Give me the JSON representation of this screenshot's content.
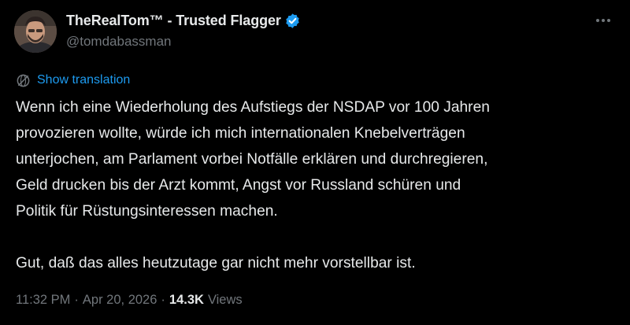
{
  "author": {
    "display_name": "TheRealTom™ - Trusted Flagger",
    "handle": "@tomdabassman",
    "verified": true,
    "avatar": "profile-photo"
  },
  "actions": {
    "more_icon": "more-horizontal-icon"
  },
  "translation": {
    "label": "Show translation",
    "icon": "globe-icon",
    "color": "#1d9bf0"
  },
  "tweet": {
    "paragraph1_lines": [
      "Wenn ich eine Wiederholung des Aufstiegs der NSDAP vor 100 Jahren",
      "provozieren wollte, würde ich mich internationalen Knebelverträgen",
      "unterjochen, am Parlament vorbei Notfälle erklären und durchregieren,",
      "Geld drucken bis der Arzt kommt, Angst vor Russland schüren und",
      "Politik für Rüstungsinteressen machen."
    ],
    "paragraph2": "Gut, daß das alles heutzutage gar nicht mehr vorstellbar ist."
  },
  "meta": {
    "time": "11:32 PM",
    "separator": "·",
    "date": "Apr 20, 2026",
    "views_count": "14.3K",
    "views_label": "Views"
  },
  "colors": {
    "background": "#000000",
    "text": "#e7e9ea",
    "secondary": "#71767b",
    "accent": "#1d9bf0"
  }
}
